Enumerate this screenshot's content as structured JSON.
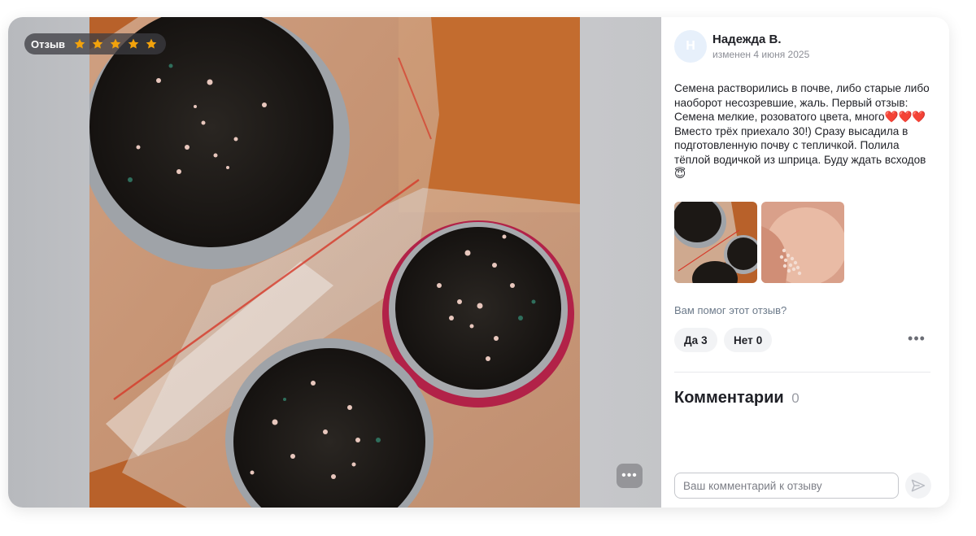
{
  "badge": {
    "label": "Отзыв",
    "rating": 5,
    "max_rating": 5,
    "star_color": "#f2a20c"
  },
  "review": {
    "avatar_letter": "Н",
    "author": "Надежда В.",
    "edited": "изменен 4 июня 2025",
    "text": "Семена растворились в почве, либо старые либо наоборот несозревшие, жаль. Первый отзыв: Семена мелкие, розоватого цвета, много❤️❤️❤️ Вместо трёх приехало 30!) Сразу высадила в подготовленную почву с тепличкой. Полила тёплой водичкой из шприца. Буду ждать всходов😇",
    "thumbnails": [
      "pots-with-soil-thumbnail",
      "seeds-on-palm-thumbnail"
    ]
  },
  "helpful": {
    "question": "Вам помог этот отзыв?",
    "yes_label": "Да",
    "yes_count": "3",
    "no_label": "Нет",
    "no_count": "0"
  },
  "comments": {
    "title": "Комментарии",
    "count": "0",
    "input_placeholder": "Ваш комментарий к отзыву"
  },
  "icons": {
    "more_photo": "ellipsis-icon",
    "more_review": "ellipsis-icon",
    "send": "send-arrow-icon",
    "star": "star-icon"
  }
}
